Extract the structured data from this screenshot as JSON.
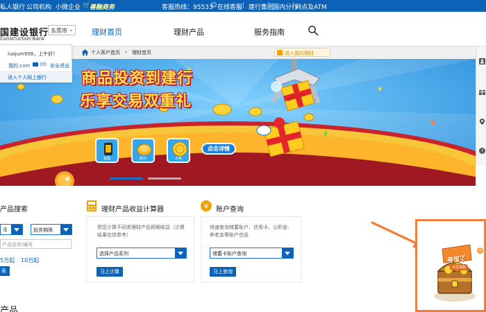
{
  "topbar": {
    "private_bank": "私人银行",
    "corporate": "公司机构",
    "small_biz": "小微企业",
    "wallet": "善融商务",
    "hotline": "客服热线：95533",
    "online_service": "在线客服",
    "group": "建行集团",
    "overseas": "国内分行",
    "atm": "网点及ATM"
  },
  "header": {
    "logo_text": "国建设银行",
    "logo_sub": "Construction Bank",
    "city": "东莞市",
    "nav": [
      "理财首页",
      "理财产品",
      "服务指南"
    ]
  },
  "login": {
    "greeting": "luojum958，上午好！",
    "mine": "我的.com",
    "mail_count": "(0)",
    "logout": "安全退出",
    "enter_personal": "进入个人网上银行"
  },
  "breadcrumb": {
    "items": [
      "个人客户首页",
      "理财首页"
    ],
    "enter_mine": "进入我的理财"
  },
  "banner": {
    "title_line1": "商品投资到建行",
    "title_line2": "乐享交易双重礼",
    "detail_button": "点击详情",
    "tiles": [
      "善融",
      "积分",
      "大奖"
    ],
    "tag": "10元话费"
  },
  "cards": {
    "search": {
      "title": "产品搜索",
      "select1": "币",
      "select2": "投资期限",
      "input_placeholder": "产品名称/编号",
      "amounts": [
        "5万起",
        "10万起"
      ],
      "button": "索"
    },
    "calculator": {
      "title": "理财产品收益计算器",
      "desc": "帮您计算不同类理财产品预期收益（计算结果仅供参考）",
      "select": "选择产品系列",
      "button": "马上计算"
    },
    "account": {
      "title": "账户查询",
      "desc": "快速查询储蓄账户、信用卡、公积金、养老金等账户信息",
      "select": "储蓄卡账户查询",
      "button": "马上查询"
    }
  },
  "bottom_heading": "产品",
  "treasure": {
    "label": "寻宝了",
    "sub": "点击领取"
  },
  "colors": {
    "brand_blue": "#0b62b6",
    "banner_sky": "#2f9de6",
    "annotation_orange": "#f07f3c"
  }
}
